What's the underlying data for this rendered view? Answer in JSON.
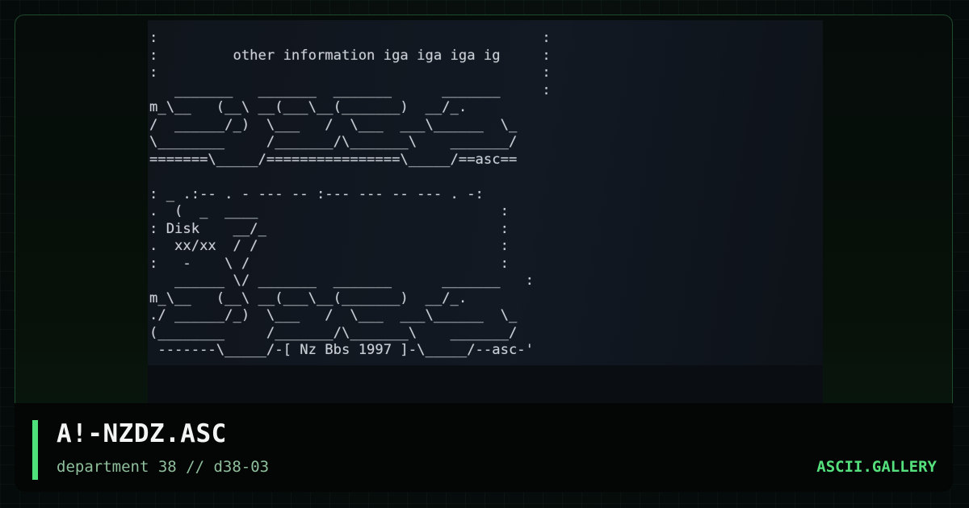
{
  "preview": {
    "ascii_lines": [
      ":                                              :",
      ":         other information iga iga iga ig     :",
      ":                                              :",
      "   _______   _______  _______      _______     :",
      "m_\\__   (__\\ __(___\\__(_______)  __/_.",
      "/  ______/_)  \\___   /  \\___  ___\\______  \\_",
      "\\________     /_______/\\_______\\    _______/",
      "=======\\_____/================\\_____/==asc==",
      "",
      ": _ .:-- . - --- -- :--- --- -- --- . -:",
      ".  (  _  ____                             :",
      ": Disk    __/_                            :",
      ".  xx/xx  / /                             :",
      ":   -    \\ /                              :",
      "   ______ \\/ _______  _______      _______   :",
      "m_\\__   (__\\ __(___\\__(_______)  __/_.",
      "./ ______/_)  \\___   /  \\___  ___\\______  \\_",
      "(________     /_______/\\_______\\    _______/",
      " -------\\_____/-[ Nz Bbs 1997 ]-\\_____/--asc-'"
    ]
  },
  "footer": {
    "title": "A!-NZDZ.ASC",
    "subtitle": "department 38 // d38-03",
    "site": "ASCII.GALLERY"
  },
  "colors": {
    "accent": "#4ee07a",
    "site_link": "#55e07d",
    "subtitle": "#8fbf9c"
  }
}
